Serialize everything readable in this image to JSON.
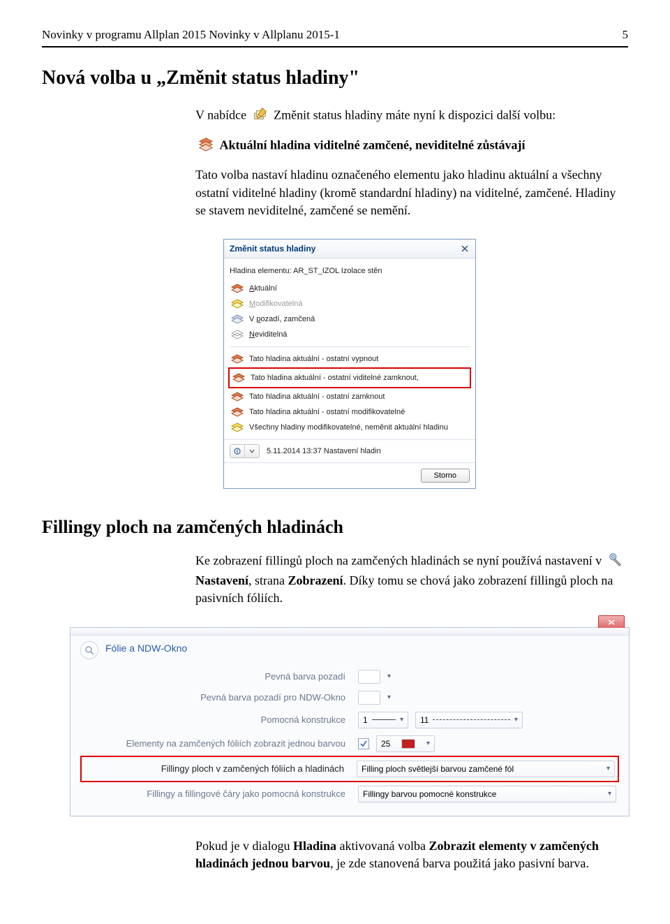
{
  "header": {
    "left": "Novinky v programu Allplan 2015  Novinky v Allplanu 2015-1",
    "right": "5"
  },
  "heading1": "Nová volba u „Změnit status hladiny\"",
  "intro": {
    "line1_pre": "V nabídce ",
    "line1_post": " Změnit status hladiny máte nyní k dispozici další volbu:",
    "line2_post": " Aktuální hladina viditelné zamčené, neviditelné zůstávají",
    "para2": "Tato volba nastaví hladinu označeného elementu jako hladinu aktuální a všechny ostatní viditelné hladiny (kromě standardní hladiny) na viditelné, zamčené. Hladiny se stavem neviditelné, zamčené se nemění."
  },
  "dialog": {
    "title": "Změnit status hladiny",
    "element_label": "Hladina elementu:  AR_ST_IZOL  Izolace stěn",
    "items_a": [
      {
        "u": "A",
        "rest": "ktuální"
      },
      {
        "u": "M",
        "rest": "odifikovatelná"
      },
      {
        "plain": "V ",
        "u": "p",
        "rest": "ozadí, zamčená"
      },
      {
        "u": "N",
        "rest": "eviditelná"
      }
    ],
    "items_b": [
      "Tato hladina aktuální - ostatní vypnout",
      "Tato hladina aktuální - ostatní viditelné zamknout,",
      "Tato hladina aktuální - ostatní zamknout",
      "Tato hladina aktuální - ostatní modifikovatelné",
      "Všechny hladiny modifikovatelné, neměnit aktuální hladinu"
    ],
    "timestamp": "5.11.2014 13:37 Nastavení hladin",
    "cancel": "Storno"
  },
  "heading2": "Fillingy ploch na zamčených hladinách",
  "para3_pre": "Ke zobrazení fillingů ploch na zamčených hladinách se nyní používá nastavení v ",
  "para3_mid": " Nastavení",
  "para3_post1": ", strana ",
  "para3_bold": "Zobrazení",
  "para3_end": ". Díky tomu se chová jako zobrazení fillingů ploch na pasivních fóliích.",
  "panel": {
    "section": "Fólie a NDW-Okno",
    "rows": [
      {
        "label": "Pevná barva pozadí"
      },
      {
        "label": "Pevná barva pozadí pro NDW-Okno"
      },
      {
        "label": "Pomocná konstrukce",
        "v1": "1",
        "v2": "11"
      },
      {
        "label": "Elementy na zamčených fóliích zobrazit jednou barvou",
        "checked": true,
        "num": "25"
      },
      {
        "label": "Fillingy ploch v zamčených fóliích a hladinách",
        "dd": "Filling ploch světlejší barvou zamčené fól"
      },
      {
        "label": "Fillingy a fillingové čáry jako pomocná konstrukce",
        "dd": "Fillingy barvou pomocné konstrukce"
      }
    ]
  },
  "para4_pre": "Pokud je v dialogu ",
  "para4_b1": "Hladina",
  "para4_mid": " aktivovaná volba ",
  "para4_b2": "Zobrazit elementy v zamčených hladinách jednou barvou",
  "para4_end": ", je zde stanovená barva použitá jako pasivní barva."
}
